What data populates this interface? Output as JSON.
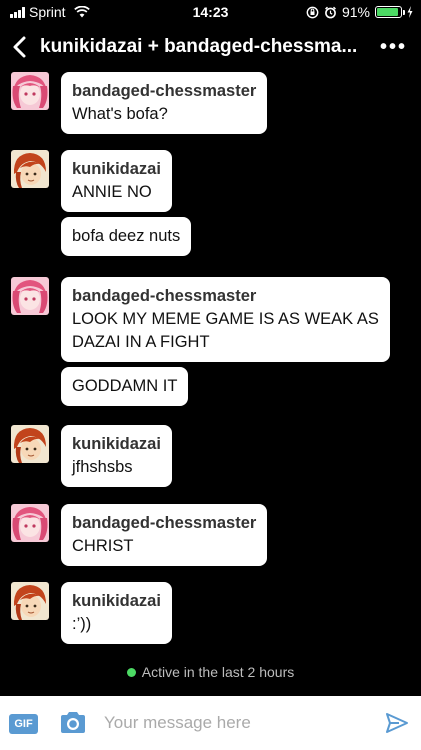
{
  "status_bar": {
    "carrier": "Sprint",
    "time": "14:23",
    "battery_percent": "91%",
    "battery_level": 0.91
  },
  "header": {
    "title": "kunikidazai + bandaged-chessma..."
  },
  "messages": [
    {
      "sender": "bandaged-chessmaster",
      "avatar": "pink-hair-avatar",
      "lines": [
        "What's bofa?"
      ]
    },
    {
      "sender": "kunikidazai",
      "avatar": "redhead-avatar",
      "lines": [
        "ANNIE NO"
      ]
    },
    {
      "sender": "",
      "avatar": "",
      "lines": [
        "bofa deez nuts"
      ]
    },
    {
      "sender": "bandaged-chessmaster",
      "avatar": "pink-hair-avatar",
      "lines": [
        "LOOK MY MEME GAME IS AS WEAK AS",
        "DAZAI IN A FIGHT"
      ]
    },
    {
      "sender": "",
      "avatar": "",
      "lines": [
        "GODDAMN IT"
      ]
    },
    {
      "sender": "kunikidazai",
      "avatar": "redhead-avatar",
      "lines": [
        "jfhshsbs"
      ]
    },
    {
      "sender": "bandaged-chessmaster",
      "avatar": "pink-hair-avatar",
      "lines": [
        "CHRIST"
      ]
    },
    {
      "sender": "kunikidazai",
      "avatar": "redhead-avatar",
      "lines": [
        ":’))"
      ]
    }
  ],
  "active_status": "Active in the last 2 hours",
  "compose": {
    "gif_label": "GIF",
    "placeholder": "Your message here"
  },
  "colors": {
    "active_dot": "#4cd964",
    "gif_badge": "#5a9ad2",
    "send_icon": "#5a9ad2"
  }
}
